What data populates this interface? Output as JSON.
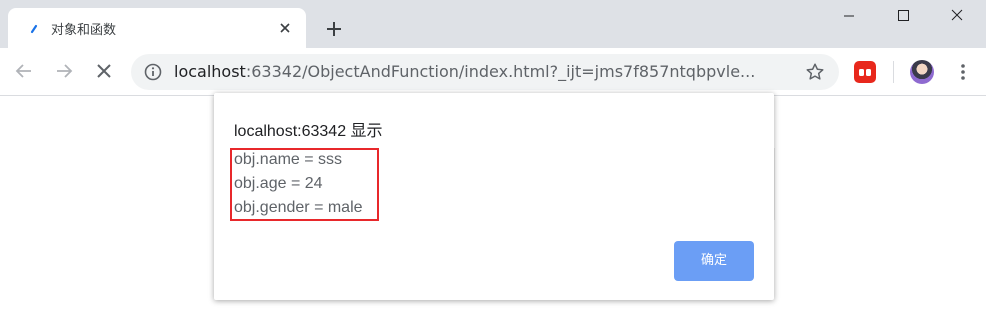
{
  "tab": {
    "title": "对象和函数",
    "close_icon": "close-icon"
  },
  "new_tab_icon": "plus-icon",
  "window_controls": [
    "minimize-icon",
    "maximize-icon",
    "close-icon"
  ],
  "toolbar": {
    "back_icon": "arrow-left-icon",
    "forward_icon": "arrow-right-icon",
    "stop_icon": "close-icon",
    "url_host": "localhost",
    "url_rest": ":63342/ObjectAndFunction/index.html?_ijt=jms7f857ntqbpvle...",
    "info_icon": "info-icon",
    "bookmark_icon": "star-icon",
    "extension_icon": "extension-icon",
    "avatar_icon": "avatar",
    "menu_icon": "more-vert-icon"
  },
  "dialog": {
    "title": "localhost:63342 显示",
    "message_lines": [
      "obj.name = sss",
      "obj.age = 24",
      "obj.gender = male"
    ],
    "ok_label": "确定"
  },
  "colors": {
    "accent_button": "#6b9ef5",
    "highlight_border": "#e8282b",
    "titlebar": "#dee1e6",
    "omnibox": "#f1f3f4"
  }
}
